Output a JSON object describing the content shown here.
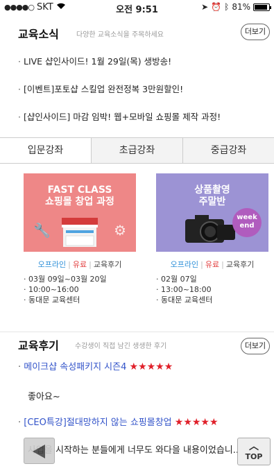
{
  "status": {
    "carrier": "SKT",
    "time": "오전 9:51",
    "battery": "81%",
    "battery_level": 0.81
  },
  "news": {
    "title": "교육소식",
    "subtitle": "다양한 교육소식을 주목하세요",
    "more_label": "더보기",
    "items": [
      "LIVE 샵인사이드! 1월 29일(목) 생방송!",
      "[이벤트]포토샵 스킬업 완전정복 3만원할인!",
      "[샵인사이드] 마감 임박! 웹+모바일 쇼핑몰 제작 과정!"
    ]
  },
  "tabs": [
    "입문강좌",
    "초급강좌",
    "중급강좌"
  ],
  "courses": [
    {
      "banner_line1": "FAST CLASS",
      "banner_line2": "쇼핑몰 창업 과정",
      "offline": "오프라인",
      "paid": "유료",
      "review": "교육후기",
      "date": "03월 09일~03월 20일",
      "time": "10:00~16:00",
      "place": "동대문 교육센터"
    },
    {
      "banner_line1": "상품촬영",
      "banner_line2": "주말반",
      "badge_top": "week",
      "badge_bottom": "end",
      "offline": "오프라인",
      "paid": "유료",
      "review": "교육후기",
      "date": "02월 07일",
      "time": "13:00~18:00",
      "place": "동대문 교육센터"
    }
  ],
  "reviews": {
    "title": "교육후기",
    "subtitle": "수강생이 직접 남긴 생생한 후기",
    "more_label": "더보기",
    "items": [
      {
        "title": "메이크샵 속성패키지 시즌4",
        "stars": "★★★★★",
        "body": "좋아요~"
      },
      {
        "title": "[CEO특강]절대망하지 않는 쇼핑몰창업",
        "stars": "★★★★★",
        "body": "사업을 시작하는 분들에게 너무도 와다을 내용이었습니..."
      }
    ]
  },
  "top_label": "TOP",
  "colors": {
    "accent_blue": "#3253c9",
    "star_red": "#e0202a",
    "banner_red": "#ee8787",
    "banner_purple": "#9c93d4"
  }
}
